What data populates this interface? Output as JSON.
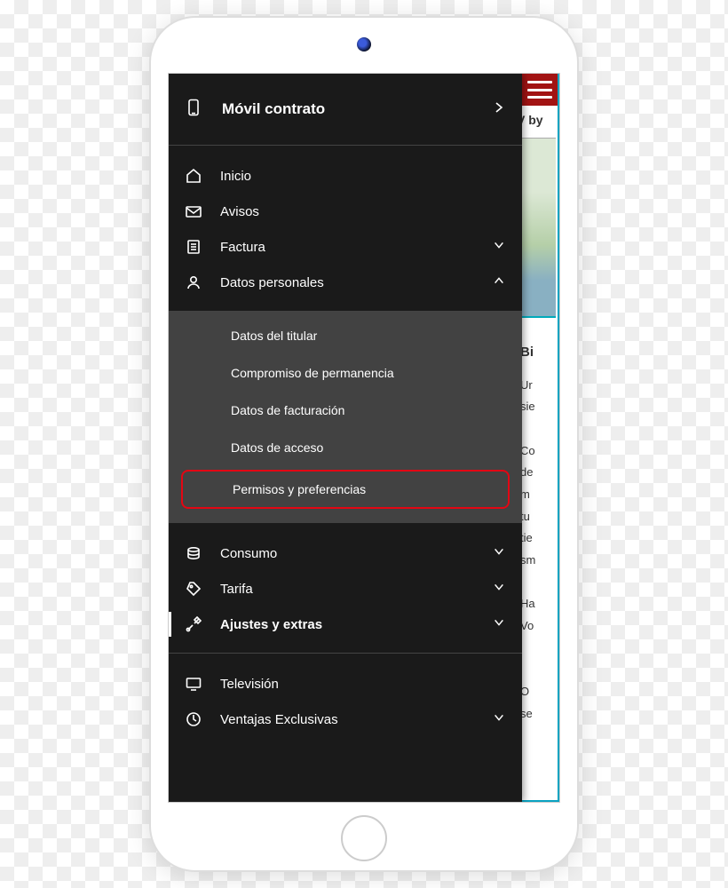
{
  "header": {
    "title": "Móvil contrato"
  },
  "menu": {
    "section1": [
      {
        "icon": "home",
        "label": "Inicio",
        "chev": ""
      },
      {
        "icon": "mail",
        "label": "Avisos",
        "chev": ""
      },
      {
        "icon": "bill",
        "label": "Factura",
        "chev": "down"
      },
      {
        "icon": "user",
        "label": "Datos personales",
        "chev": "up",
        "expanded": true
      }
    ],
    "sub_datos": [
      {
        "label": "Datos del titular"
      },
      {
        "label": "Compromiso de permanencia"
      },
      {
        "label": "Datos de facturación"
      },
      {
        "label": "Datos de acceso"
      },
      {
        "label": "Permisos y preferencias",
        "highlight": true
      }
    ],
    "section2": [
      {
        "icon": "coins",
        "label": "Consumo",
        "chev": "down"
      },
      {
        "icon": "tag",
        "label": "Tarifa",
        "chev": "down"
      },
      {
        "icon": "tools",
        "label": "Ajustes y extras",
        "chev": "down",
        "bold": true,
        "active": true
      }
    ],
    "section3": [
      {
        "icon": "tv",
        "label": "Televisión",
        "chev": ""
      },
      {
        "icon": "star",
        "label": "Ventajas Exclusivas",
        "chev": "down"
      }
    ]
  },
  "background": {
    "promo": "V by",
    "heading": "Bi",
    "lines": [
      "Ur",
      "sie",
      "",
      "Co",
      "de",
      "m",
      "tu",
      "tie",
      "sm",
      "",
      "Ha",
      "Vo",
      "",
      "",
      "O",
      "se"
    ]
  }
}
